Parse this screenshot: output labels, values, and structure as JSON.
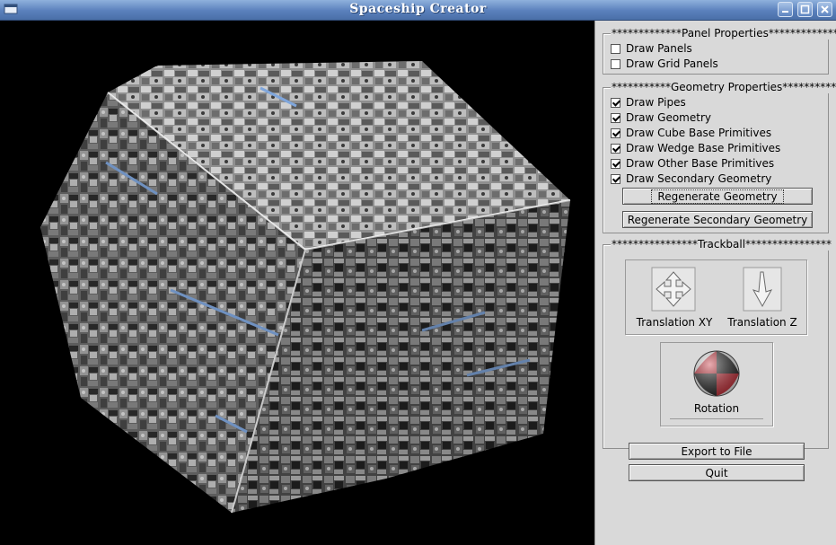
{
  "window": {
    "title": "Spaceship Creator"
  },
  "panel_properties": {
    "title": "*************Panel Properties*************",
    "draw_panels": {
      "label": "Draw Panels",
      "checked": false
    },
    "draw_grid_panels": {
      "label": "Draw Grid Panels",
      "checked": false
    }
  },
  "geometry_properties": {
    "title": "***********Geometry Properties***********",
    "items": [
      {
        "label": "Draw Pipes",
        "checked": true
      },
      {
        "label": "Draw Geometry",
        "checked": true
      },
      {
        "label": "Draw Cube Base Primitives",
        "checked": true
      },
      {
        "label": "Draw Wedge Base Primitives",
        "checked": true
      },
      {
        "label": "Draw Other Base Primitives",
        "checked": true
      },
      {
        "label": "Draw Secondary Geometry",
        "checked": true
      }
    ],
    "regenerate_label": "Regenerate Geometry",
    "regenerate_secondary_label": "Regenerate Secondary Geometry"
  },
  "trackball": {
    "title": "****************Trackball****************",
    "translation_xy": "Translation XY",
    "translation_z": "Translation Z",
    "rotation": "Rotation"
  },
  "actions": {
    "export_label": "Export to File",
    "quit_label": "Quit"
  },
  "colors": {
    "titlebar": "#5a80bc",
    "panel_bg": "#d9d9d9",
    "viewport_bg": "#000000",
    "pipe_accent": "#7fa6dc"
  }
}
